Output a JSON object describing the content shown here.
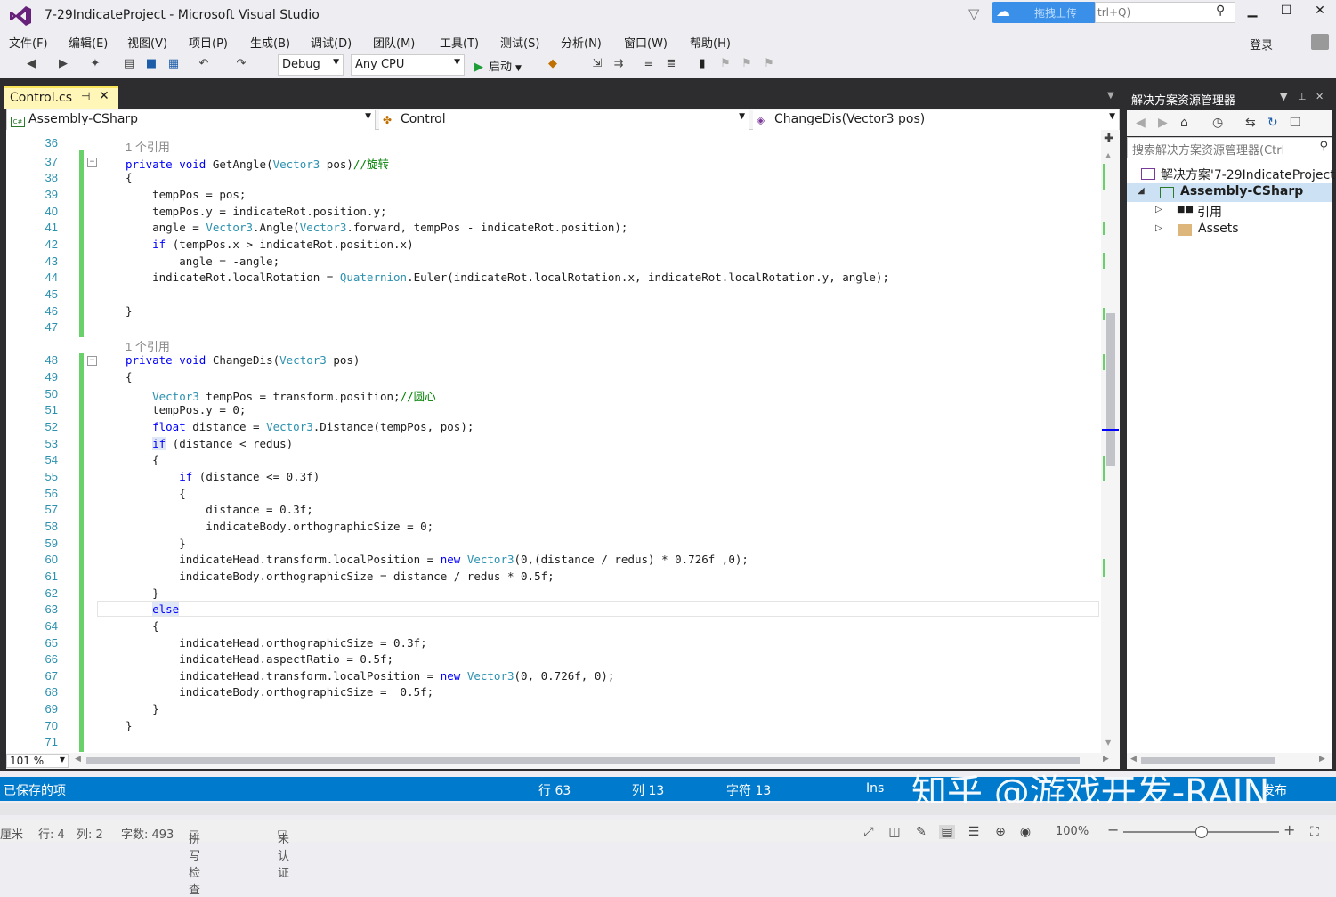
{
  "window": {
    "title": "7-29IndicateProject - Microsoft Visual Studio",
    "upload_label": "拖拽上传",
    "quick_launch": "trl+Q)",
    "minimize": "▁",
    "maximize": "☐",
    "close": "✕"
  },
  "menu": {
    "items": [
      "文件(F)",
      "编辑(E)",
      "视图(V)",
      "项目(P)",
      "生成(B)",
      "调试(D)",
      "团队(M)",
      "工具(T)",
      "测试(S)",
      "分析(N)",
      "窗口(W)",
      "帮助(H)"
    ],
    "login": "登录"
  },
  "toolbar": {
    "config": "Debug",
    "platform": "Any CPU",
    "start": "启动"
  },
  "tab": {
    "label": "Control.cs",
    "pin": "⊣",
    "close": "✕"
  },
  "navbar": {
    "project": "Assembly-CSharp",
    "class": "Control",
    "member": "ChangeDis(Vector3 pos)"
  },
  "editor": {
    "partial_top_line": "36",
    "lines": [
      {
        "lens": "1 个引用"
      },
      {
        "n": "37",
        "fold": "−",
        "chg": true,
        "c": [
          [
            "kw",
            "private "
          ],
          [
            "kw",
            "void "
          ],
          [
            "",
            "GetAngle("
          ],
          [
            "ty",
            "Vector3"
          ],
          [
            "",
            " pos)"
          ],
          [
            "cm",
            "//旋转"
          ]
        ]
      },
      {
        "n": "38",
        "chg": true,
        "c": [
          [
            "",
            "{"
          ]
        ]
      },
      {
        "n": "39",
        "chg": true,
        "c": [
          [
            "",
            "    tempPos = pos;"
          ]
        ]
      },
      {
        "n": "40",
        "chg": true,
        "c": [
          [
            "",
            "    tempPos.y = indicateRot.position.y;"
          ]
        ]
      },
      {
        "n": "41",
        "chg": true,
        "c": [
          [
            "",
            "    angle = "
          ],
          [
            "ty",
            "Vector3"
          ],
          [
            "",
            ".Angle("
          ],
          [
            "ty",
            "Vector3"
          ],
          [
            "",
            ".forward, tempPos - indicateRot.position);"
          ]
        ]
      },
      {
        "n": "42",
        "chg": true,
        "c": [
          [
            "kw",
            "    if "
          ],
          [
            "",
            "(tempPos.x > indicateRot.position.x)"
          ]
        ]
      },
      {
        "n": "43",
        "chg": true,
        "c": [
          [
            "",
            "        angle = -angle;"
          ]
        ]
      },
      {
        "n": "44",
        "chg": true,
        "c": [
          [
            "",
            "    indicateRot.localRotation = "
          ],
          [
            "ty",
            "Quaternion"
          ],
          [
            "",
            ".Euler(indicateRot.localRotation.x, indicateRot.localRotation.y, angle);"
          ]
        ]
      },
      {
        "n": "45",
        "chg": true,
        "c": [
          [
            "",
            ""
          ]
        ]
      },
      {
        "n": "46",
        "chg": true,
        "c": [
          [
            "",
            "}"
          ]
        ]
      },
      {
        "n": "47",
        "chg": true,
        "c": [
          [
            "",
            ""
          ]
        ]
      },
      {
        "lens": "1 个引用"
      },
      {
        "n": "48",
        "fold": "−",
        "chg": true,
        "c": [
          [
            "kw",
            "private "
          ],
          [
            "kw",
            "void "
          ],
          [
            "",
            "ChangeDis("
          ],
          [
            "ty",
            "Vector3"
          ],
          [
            "",
            " pos)"
          ]
        ]
      },
      {
        "n": "49",
        "chg": true,
        "c": [
          [
            "",
            "{"
          ]
        ]
      },
      {
        "n": "50",
        "chg": true,
        "c": [
          [
            "ty",
            "    Vector3"
          ],
          [
            "",
            " tempPos = transform.position;"
          ],
          [
            "cm",
            "//圆心"
          ]
        ]
      },
      {
        "n": "51",
        "chg": true,
        "c": [
          [
            "",
            "    tempPos.y = 0;"
          ]
        ]
      },
      {
        "n": "52",
        "chg": true,
        "c": [
          [
            "kw",
            "    float "
          ],
          [
            "",
            "distance = "
          ],
          [
            "ty",
            "Vector3"
          ],
          [
            "",
            ".Distance(tempPos, pos);"
          ]
        ]
      },
      {
        "n": "53",
        "chg": true,
        "c": [
          [
            "",
            "    "
          ],
          [
            "kw hl",
            "if"
          ],
          [
            "",
            " (distance < redus)"
          ]
        ]
      },
      {
        "n": "54",
        "chg": true,
        "c": [
          [
            "",
            "    {"
          ]
        ]
      },
      {
        "n": "55",
        "chg": true,
        "c": [
          [
            "kw",
            "        if "
          ],
          [
            "",
            "(distance <= 0.3f)"
          ]
        ]
      },
      {
        "n": "56",
        "chg": true,
        "c": [
          [
            "",
            "        {"
          ]
        ]
      },
      {
        "n": "57",
        "chg": true,
        "c": [
          [
            "",
            "            distance = 0.3f;"
          ]
        ]
      },
      {
        "n": "58",
        "chg": true,
        "c": [
          [
            "",
            "            indicateBody.orthographicSize = 0;"
          ]
        ]
      },
      {
        "n": "59",
        "chg": true,
        "c": [
          [
            "",
            "        }"
          ]
        ]
      },
      {
        "n": "60",
        "chg": true,
        "c": [
          [
            "",
            "        indicateHead.transform.localPosition = "
          ],
          [
            "kw",
            "new "
          ],
          [
            "ty",
            "Vector3"
          ],
          [
            "",
            "(0,(distance / redus) * 0.726f ,0);"
          ]
        ]
      },
      {
        "n": "61",
        "chg": true,
        "c": [
          [
            "",
            "        indicateBody.orthographicSize = distance / redus * 0.5f;"
          ]
        ]
      },
      {
        "n": "62",
        "chg": true,
        "c": [
          [
            "",
            "    }"
          ]
        ]
      },
      {
        "n": "63",
        "chg": true,
        "c": [
          [
            "",
            "    "
          ],
          [
            "kw hl",
            "else"
          ]
        ]
      },
      {
        "n": "64",
        "chg": true,
        "c": [
          [
            "",
            "    {"
          ]
        ]
      },
      {
        "n": "65",
        "chg": true,
        "c": [
          [
            "",
            "        indicateHead.orthographicSize = 0.3f;"
          ]
        ]
      },
      {
        "n": "66",
        "chg": true,
        "c": [
          [
            "",
            "        indicateHead.aspectRatio = 0.5f;"
          ]
        ]
      },
      {
        "n": "67",
        "chg": true,
        "c": [
          [
            "",
            "        indicateHead.transform.localPosition = "
          ],
          [
            "kw",
            "new "
          ],
          [
            "ty",
            "Vector3"
          ],
          [
            "",
            "(0, 0.726f, 0);"
          ]
        ]
      },
      {
        "n": "68",
        "chg": true,
        "c": [
          [
            "",
            "        indicateBody.orthographicSize =  0.5f;"
          ]
        ]
      },
      {
        "n": "69",
        "chg": true,
        "c": [
          [
            "",
            "    }"
          ]
        ]
      },
      {
        "n": "70",
        "chg": true,
        "c": [
          [
            "",
            "}"
          ]
        ]
      },
      {
        "n": "71",
        "chg": true,
        "c": [
          [
            "",
            ""
          ]
        ]
      }
    ],
    "zoom": "101 %"
  },
  "solution_explorer": {
    "title": "解决方案资源管理器",
    "search_placeholder": "搜索解决方案资源管理器(Ctrl",
    "tree": [
      {
        "label": "解决方案'7-29IndicateProject",
        "bold": false,
        "selected": false
      },
      {
        "label": "Assembly-CSharp",
        "bold": true,
        "selected": true
      },
      {
        "label": "引用",
        "bold": false,
        "selected": false
      },
      {
        "label": "Assets",
        "bold": false,
        "selected": false
      }
    ]
  },
  "status": {
    "saved": "已保存的项",
    "row": "行 63",
    "col": "列 13",
    "char": "字符 13",
    "ins": "Ins",
    "publish": "发布"
  },
  "watermark": "知乎 @游戏开发-RAIN",
  "bottom": {
    "unit": "厘米",
    "row": "行: 4",
    "col": "列: 2",
    "words": "字数: 493",
    "spell": "拼写检查",
    "auth": "未认证",
    "zoom": "100%"
  },
  "colors": {
    "accent": "#007acc",
    "keyword": "#0000ff",
    "type": "#2b91af",
    "comment": "#008000",
    "change_marker": "#6ad06a",
    "tab_active": "#fff6b8"
  }
}
